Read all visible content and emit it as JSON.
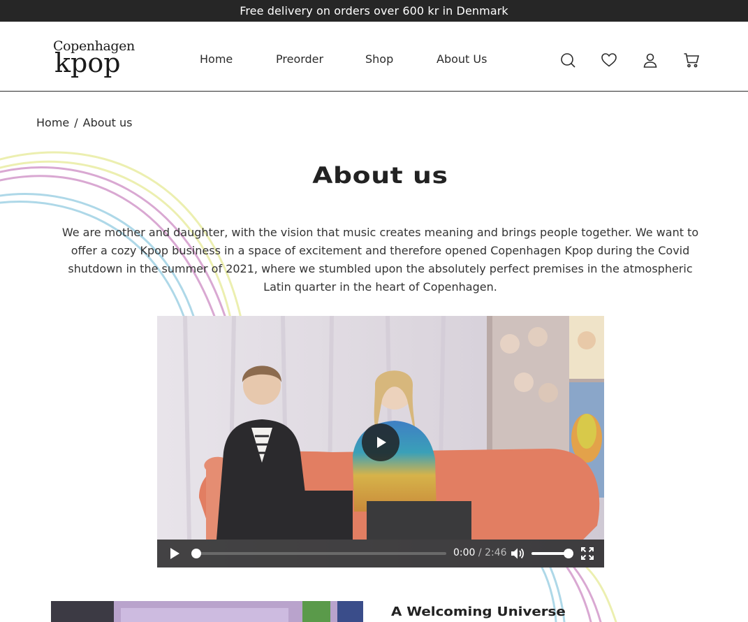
{
  "announcement": "Free delivery on orders over 600 kr in Denmark",
  "logo": {
    "line1": "Copenhagen",
    "line2": "kpop"
  },
  "nav": [
    {
      "label": "Home"
    },
    {
      "label": "Preorder"
    },
    {
      "label": "Shop"
    },
    {
      "label": "About Us"
    }
  ],
  "header_icons": [
    "search-icon",
    "heart-icon",
    "account-icon",
    "cart-icon"
  ],
  "breadcrumb": {
    "home": "Home",
    "separator": "/",
    "current": "About us"
  },
  "page": {
    "title": "About us",
    "intro": "We are mother and daughter, with the vision that music creates meaning and brings people together. We want to offer a cozy Kpop business in a space of excitement and therefore opened Copenhagen Kpop during the Covid shutdown in the summer of 2021, where we stumbled upon the absolutely perfect premises in the atmospheric Latin quarter in the heart of Copenhagen."
  },
  "video": {
    "current_time": "0:00",
    "time_separator": "/",
    "duration": "2:46",
    "progress": 0,
    "volume": 1
  },
  "section": {
    "heading": "A Welcoming Universe"
  },
  "colors": {
    "topbar_bg": "#262626",
    "swirl_pink": "#d9a8d2",
    "swirl_yellow": "#ecefb0",
    "swirl_blue": "#aed8e8"
  }
}
